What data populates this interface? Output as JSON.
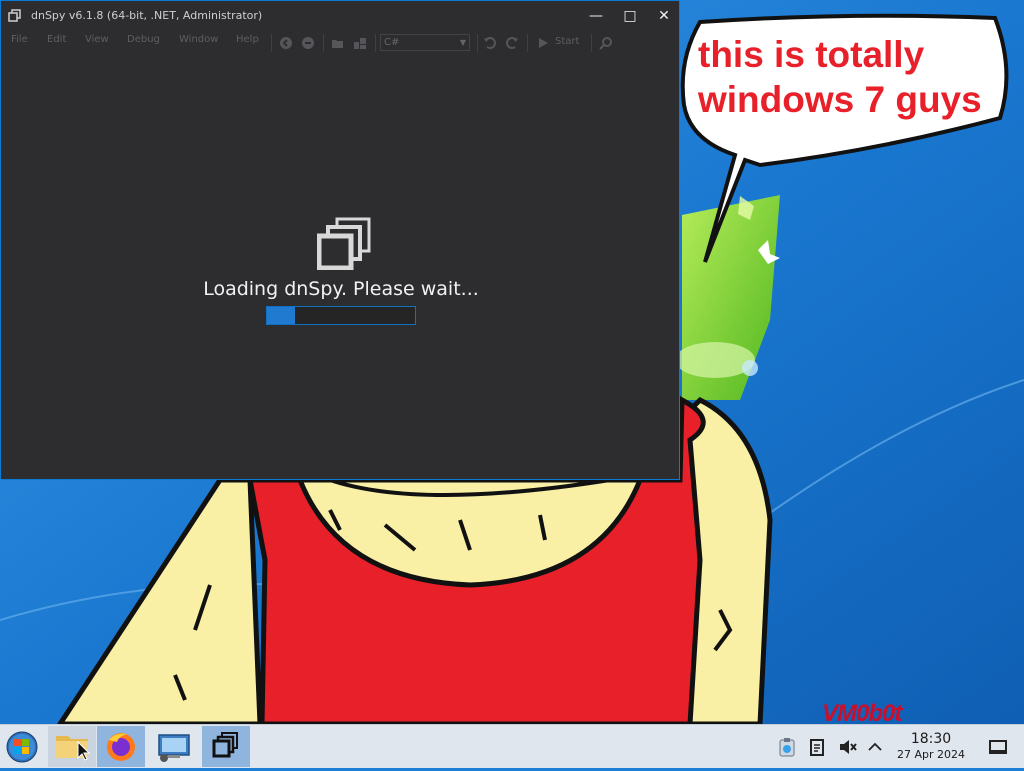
{
  "window": {
    "title": "dnSpy v6.1.8 (64-bit, .NET, Administrator)",
    "controls": {
      "minimize": "—",
      "maximize": "□",
      "close": "✕"
    },
    "menu": [
      "File",
      "Edit",
      "View",
      "Debug",
      "Window",
      "Help"
    ],
    "toolbar": {
      "language": "C#",
      "start_label": "Start",
      "icons": [
        "back-icon",
        "forward-icon",
        "open-icon",
        "open-list-icon",
        "undo-icon",
        "redo-icon",
        "start-icon",
        "search-icon"
      ]
    },
    "loading": {
      "message": "Loading dnSpy. Please wait...",
      "progress": 0.19
    }
  },
  "wallpaper": {
    "speech_bubble": "this is totally windows 7 guys",
    "signature": "VM0b0t",
    "colors": {
      "sky": "#1e7fd6",
      "shirt": "#e8202a",
      "skin": "#f9f0a6",
      "leaf": "#7bd12f"
    }
  },
  "taskbar": {
    "apps": [
      "start-orb-icon",
      "file-explorer-icon",
      "firefox-icon",
      "remote-desktop-icon",
      "dnspy-icon"
    ],
    "tray": {
      "time": "18:30",
      "date": "27 Apr 2024",
      "icons": [
        "clipboard-icon",
        "notes-icon",
        "volume-muted-icon",
        "show-hidden-icon",
        "desktop-icon"
      ]
    }
  },
  "colors": {
    "window_bg": "#2d2d30",
    "accent": "#0c7bd6",
    "taskbar_bg": "#dfe6ee"
  }
}
